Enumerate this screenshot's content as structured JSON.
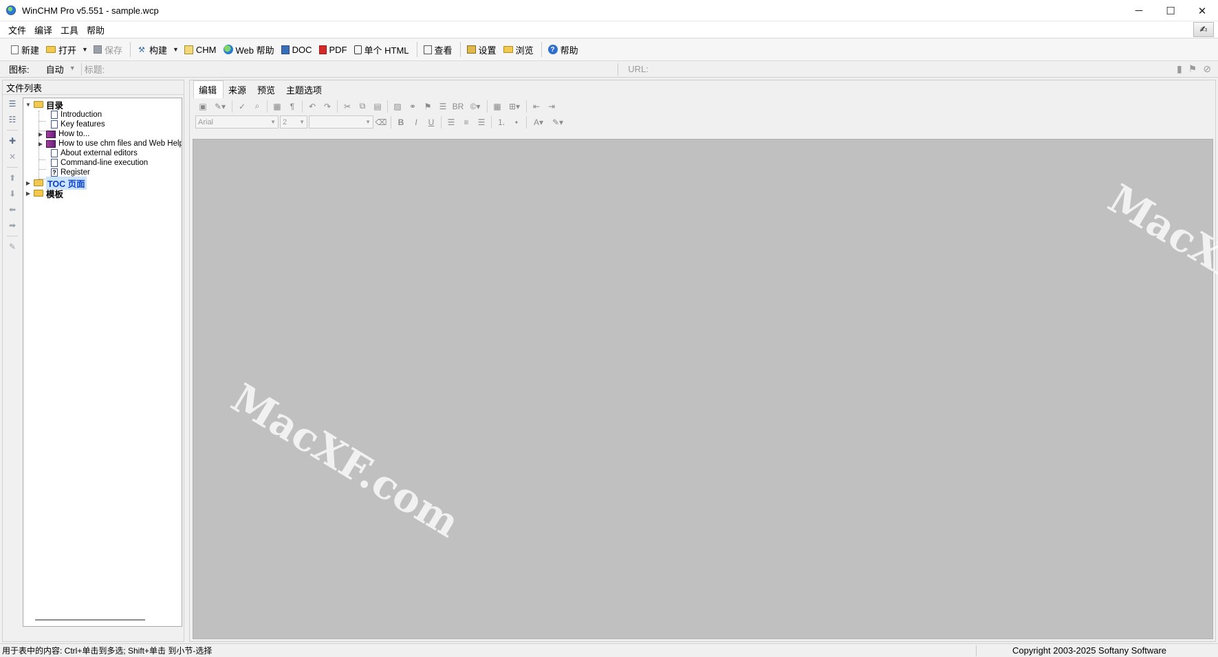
{
  "window": {
    "title": "WinCHM Pro v5.551 - sample.wcp",
    "controls": {
      "minimize": "─",
      "maximize": "☐",
      "close": "✕"
    }
  },
  "menu": [
    "文件",
    "编译",
    "工具",
    "帮助"
  ],
  "toolbar": {
    "new": "新建",
    "open": "打开",
    "save": "保存",
    "build": "构建",
    "chm": "CHM",
    "web_help": "Web 帮助",
    "doc": "DOC",
    "pdf": "PDF",
    "single_html": "单个 HTML",
    "view": "查看",
    "settings": "设置",
    "browse": "浏览",
    "help": "帮助"
  },
  "propbar": {
    "icon_label": "图标:",
    "icon_value": "自动",
    "title_label": "标题:",
    "title_value": "",
    "url_label": "URL:",
    "url_value": ""
  },
  "left_panel": {
    "title": "文件列表",
    "tree": {
      "root": "目录",
      "children": [
        "Introduction",
        "Key features",
        "How to...",
        "How to use chm files and Web Help",
        "About external editors",
        "Command-line execution",
        "Register"
      ],
      "toc_pages": "TOC 页面",
      "templates": "模板"
    }
  },
  "editor": {
    "tabs": [
      "编辑",
      "来源",
      "预览",
      "主题选项"
    ],
    "font": "Arial",
    "size": "2",
    "style": ""
  },
  "watermark": "MacXF.com",
  "status": {
    "hint": "用于表中的内容: Ctrl+单击到多选; Shift+单击 到小节-选择",
    "copyright": "Copyright 2003-2025 Softany Software"
  }
}
